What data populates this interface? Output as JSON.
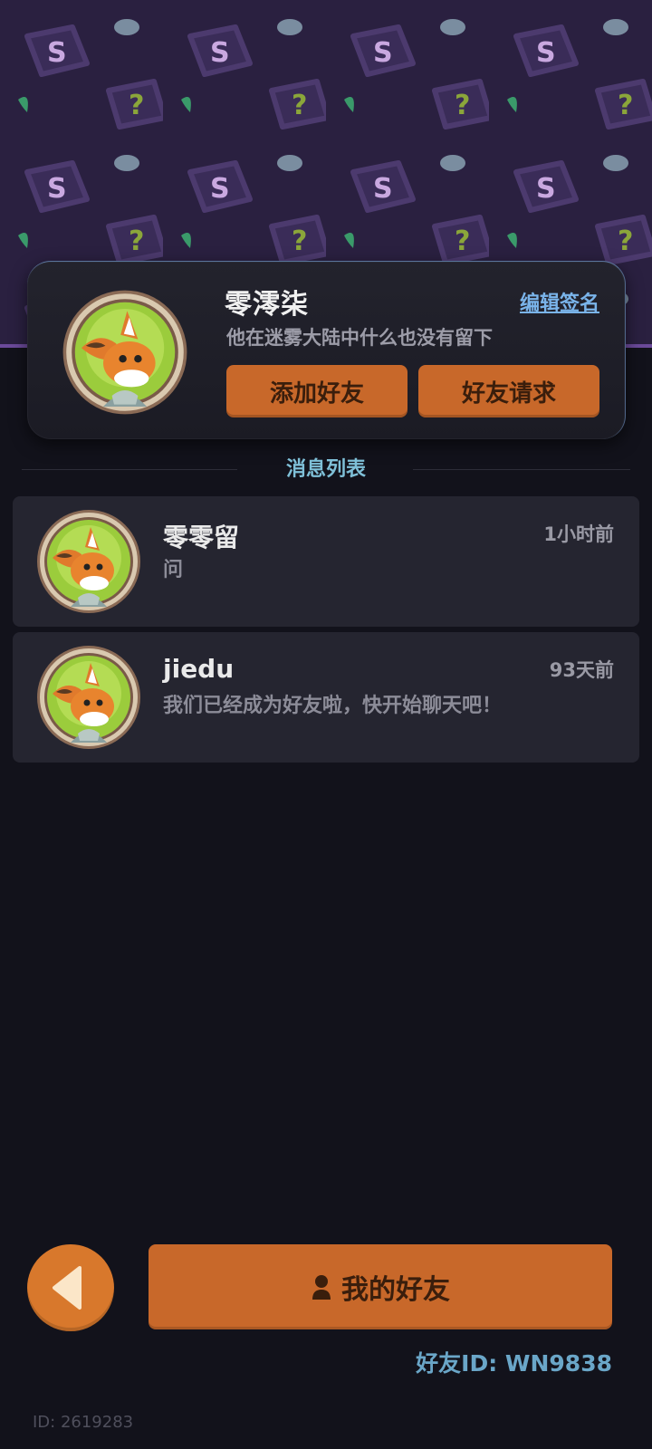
{
  "profile": {
    "name": "零澪柒",
    "edit_sign_label": "编辑签名",
    "signature": "他在迷雾大陆中什么也没有留下",
    "add_friend_label": "添加好友",
    "friend_request_label": "好友请求",
    "avatar_icon": "fox-avatar-icon"
  },
  "section": {
    "title": "消息列表"
  },
  "messages": [
    {
      "sender": "零零留",
      "time": "1小时前",
      "preview": "问",
      "avatar_icon": "fox-avatar-icon"
    },
    {
      "sender": "jiedu",
      "time": "93天前",
      "preview": "我们已经成为好友啦，快开始聊天吧！",
      "avatar_icon": "fox-avatar-icon"
    }
  ],
  "bottom": {
    "back_icon": "back-arrow-icon",
    "my_friends_label": "我的好友",
    "my_friends_icon": "person-icon",
    "friend_id": "好友ID: WN9838",
    "user_id": "ID: 2619283"
  },
  "colors": {
    "accent_orange": "#c8682a",
    "banner_purple": "#2a2040",
    "link_blue": "#7ab4ea",
    "section_teal": "#7fc0d8"
  }
}
